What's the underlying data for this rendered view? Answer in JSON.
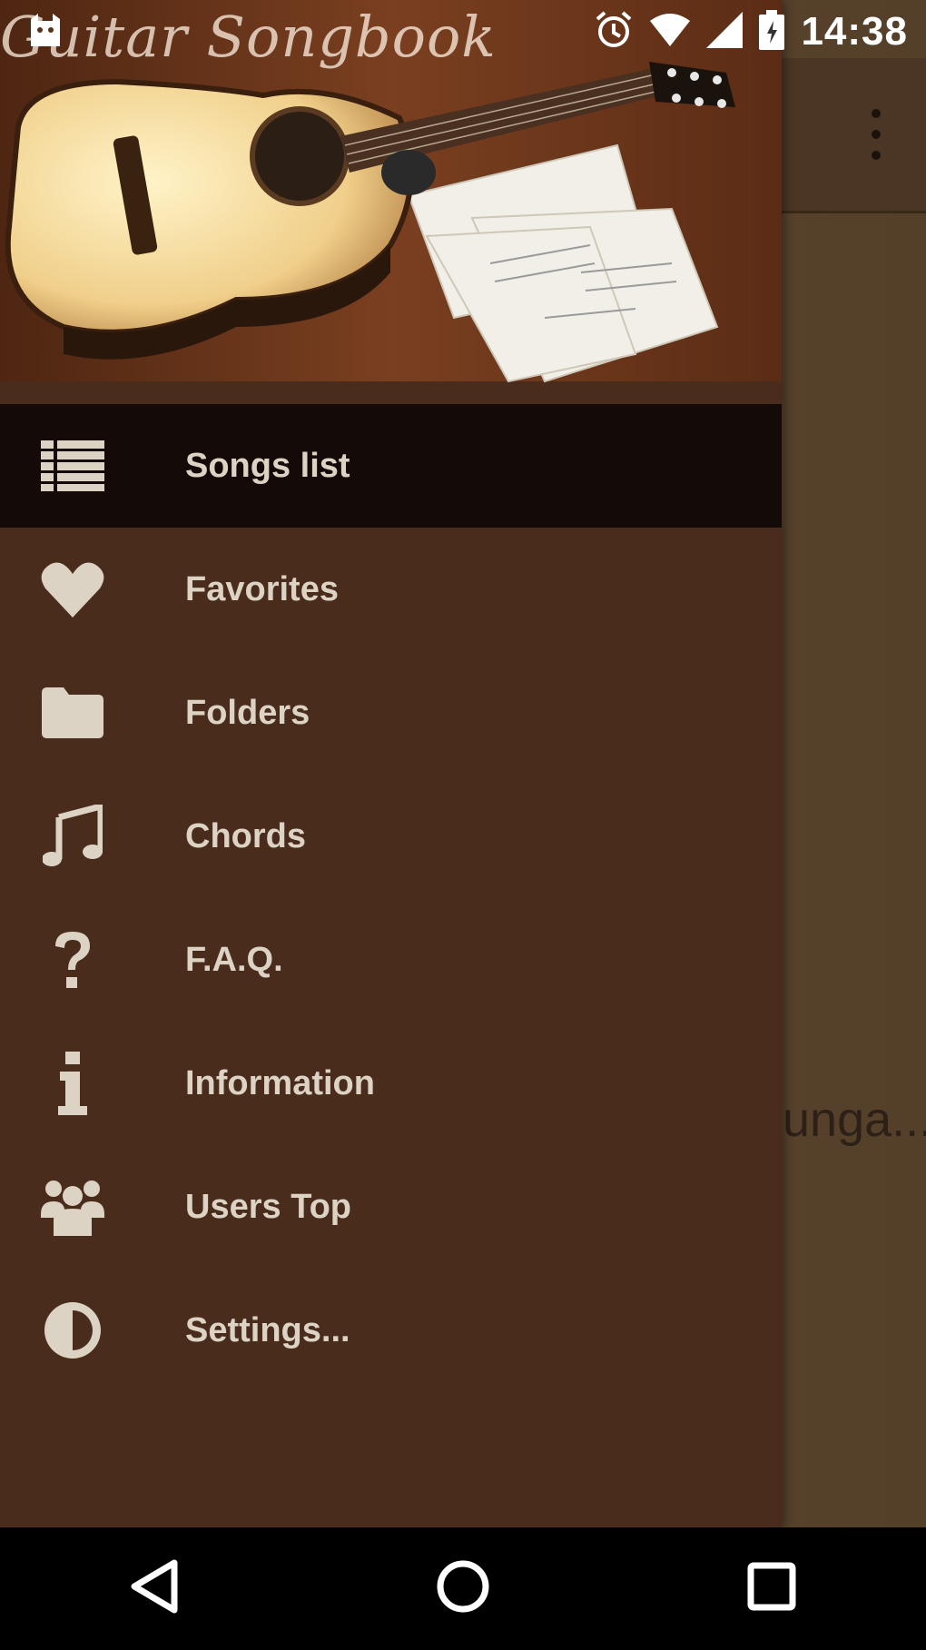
{
  "status_bar": {
    "time": "14:38",
    "icons": [
      "app-notification-icon",
      "alarm-icon",
      "wifi-icon",
      "signal-icon",
      "battery-icon"
    ]
  },
  "header": {
    "app_logo_text": "Guitar Songbook"
  },
  "menu": {
    "items": [
      {
        "label": "Songs list",
        "icon": "list-icon",
        "active": true
      },
      {
        "label": "Favorites",
        "icon": "heart-icon",
        "active": false
      },
      {
        "label": "Folders",
        "icon": "folder-icon",
        "active": false
      },
      {
        "label": "Chords",
        "icon": "music-note-icon",
        "active": false
      },
      {
        "label": "F.A.Q.",
        "icon": "question-icon",
        "active": false
      },
      {
        "label": "Information",
        "icon": "info-icon",
        "active": false
      },
      {
        "label": "Users Top",
        "icon": "users-icon",
        "active": false
      },
      {
        "label": "Settings...",
        "icon": "contrast-icon",
        "active": false
      }
    ]
  },
  "background": {
    "partial_text": "unga..."
  },
  "colors": {
    "drawer_bg": "#4a2c1d",
    "active_item_bg": "#140b08",
    "icon_color": "#ddd3c4",
    "text_color": "#ddd3c4"
  }
}
